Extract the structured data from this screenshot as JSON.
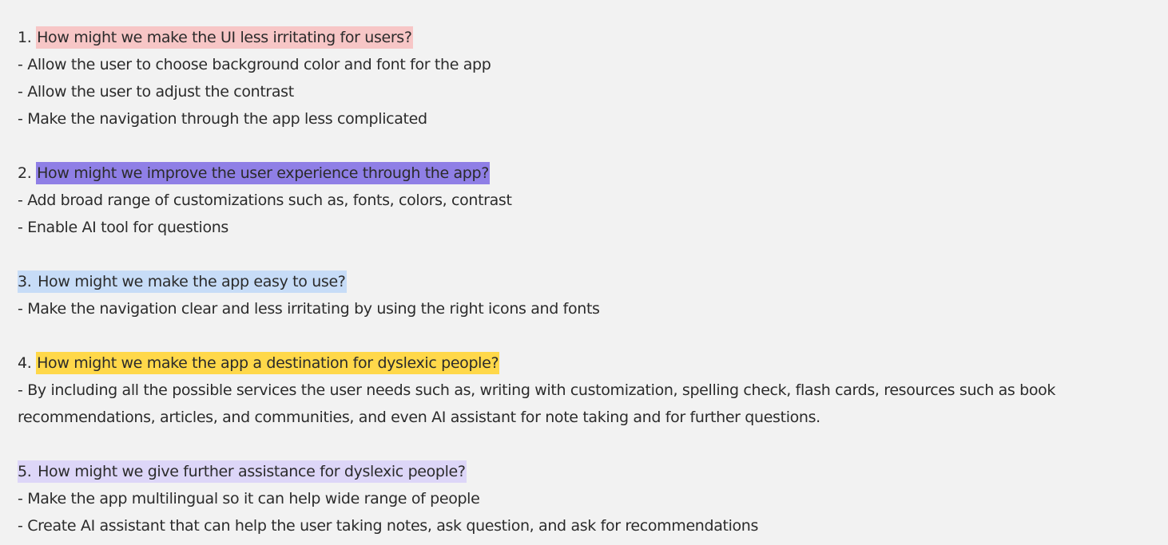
{
  "colors": {
    "background": "#f2f2f2",
    "text": "#2b2b2b",
    "q1_highlight": "#f7c6c6",
    "q2_highlight": "#8f7fe6",
    "q3_highlight": "#c7dcf7",
    "q4_highlight": "#ffd84a",
    "q5_highlight": "#ddd6f8"
  },
  "sections": [
    {
      "number": "1.",
      "question": "How might we make the UI less irritating for users?",
      "answers": [
        "- Allow the user to choose background color and font for the app",
        "- Allow the user to adjust the contrast",
        "- Make the navigation through the app less complicated"
      ]
    },
    {
      "number": "2.",
      "question": "How might we improve the user experience through the app?",
      "answers": [
        "- Add broad range of customizations such as, fonts, colors, contrast",
        "- Enable AI tool for questions"
      ]
    },
    {
      "number": "3.",
      "question": "How might we make the app easy to use?",
      "answers": [
        "- Make the navigation clear and less irritating by using the right icons and fonts"
      ]
    },
    {
      "number": "4.",
      "question": "How might we make the app a destination for dyslexic people?",
      "answers": [
        "- By including all the possible services the user needs such as, writing with customization, spelling check, flash cards, resources such as book recommendations, articles, and communities, and even AI assistant for note taking and for further questions."
      ]
    },
    {
      "number": "5.",
      "question": "How might we give further assistance for dyslexic people?",
      "answers": [
        "- Make the app multilingual so it can help wide range of people",
        "- Create AI assistant that can help the user taking notes, ask question, and ask for recommendations"
      ]
    }
  ]
}
